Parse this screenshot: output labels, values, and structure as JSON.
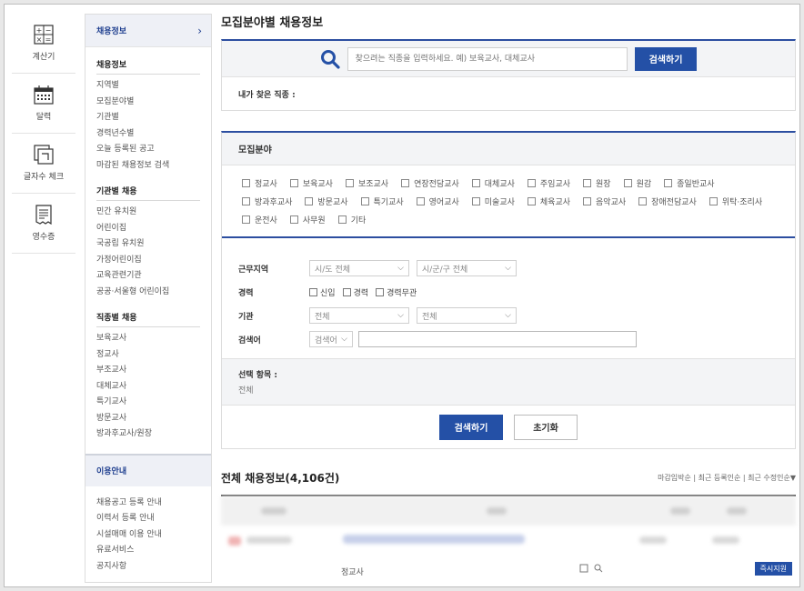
{
  "tools": [
    {
      "label": "계산기",
      "icon": "calculator-icon"
    },
    {
      "label": "달력",
      "icon": "calendar-icon"
    },
    {
      "label": "글자수 체크",
      "icon": "char-count-icon"
    },
    {
      "label": "영수증",
      "icon": "receipt-icon"
    }
  ],
  "side": {
    "head": "채용정보",
    "groups": [
      {
        "title": "채용정보",
        "items": [
          "지역별",
          "모집분야별",
          "기관별",
          "경력년수별",
          "오늘 등록된 공고",
          "마감된 채용정보 검색"
        ]
      },
      {
        "title": "기관별 채용",
        "items": [
          "민간 유치원",
          "어린이집",
          "국공립 유치원",
          "가정어린이집",
          "교육관련기관",
          "공공·서울형 어린이집"
        ]
      },
      {
        "title": "직종별 채용",
        "items": [
          "보육교사",
          "정교사",
          "부조교사",
          "대체교사",
          "특기교사",
          "방문교사",
          "방과후교사/원장"
        ]
      }
    ],
    "guide_head": "이용안내",
    "guide_items": [
      "채용공고 등록 안내",
      "이력서 등록 안내",
      "시설매매 이용 안내",
      "유료서비스",
      "공지사항"
    ]
  },
  "main": {
    "title": "모집분야별 채용정보",
    "search": {
      "placeholder": "찾으려는 직종을 입력하세요. 예) 보육교사, 대체교사",
      "button": "검색하기",
      "my_job_label": "내가 찾은 직종 :"
    },
    "fields": {
      "head": "모집분야",
      "items": [
        "정교사",
        "보육교사",
        "보조교사",
        "연장전담교사",
        "대체교사",
        "주임교사",
        "원장",
        "원감",
        "종일반교사",
        "방과후교사",
        "방문교사",
        "특기교사",
        "영어교사",
        "미술교사",
        "체육교사",
        "음악교사",
        "장애전담교사",
        "위탁·조리사",
        "운전사",
        "사무원",
        "기타"
      ]
    },
    "filters": {
      "region_label": "근무지역",
      "region_sido": "시/도 전체",
      "region_sigungu": "시/군/구 전체",
      "career_label": "경력",
      "career_opts": [
        "신입",
        "경력",
        "경력무관"
      ],
      "org_label": "기관",
      "org_sel1": "전체",
      "org_sel2": "전체",
      "keyword_label": "검색어",
      "keyword_sel": "검색어"
    },
    "selected": {
      "label": "선택 항목 :",
      "value": "전체"
    },
    "actions": {
      "search": "검색하기",
      "reset": "초기화"
    },
    "list": {
      "title": "전체 채용정보(4,106건)",
      "sorts": [
        "마감임박순",
        "최근 등록인순",
        "최근 수정인순▼"
      ],
      "row_sub": "정교사",
      "badge": "즉시지원"
    }
  }
}
